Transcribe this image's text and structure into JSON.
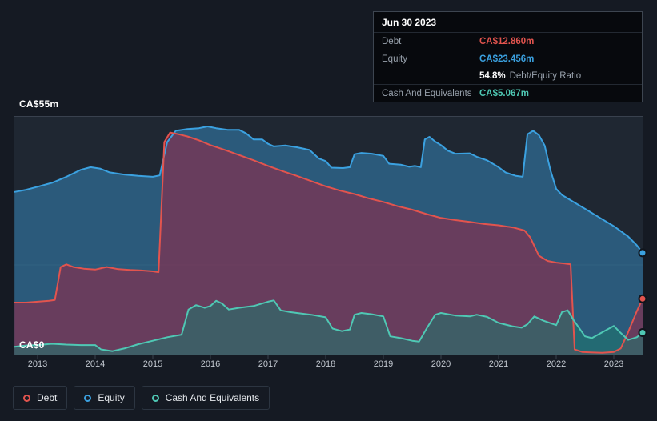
{
  "colors": {
    "debt": "#e2544e",
    "equity": "#3ba1e0",
    "cash": "#4fc8b4",
    "background": "#151a23",
    "plot_background": "#1f2732",
    "gridline": "#39414e",
    "muted_text": "#98a1ac"
  },
  "tooltip": {
    "date": "Jun 30 2023",
    "debt_label": "Debt",
    "debt_value": "CA$12.860m",
    "equity_label": "Equity",
    "equity_value": "CA$23.456m",
    "ratio_value": "54.8%",
    "ratio_label": "Debt/Equity Ratio",
    "cash_label": "Cash And Equivalents",
    "cash_value": "CA$5.067m"
  },
  "axis": {
    "y_top_label": "CA$55m",
    "y_zero_label": "CA$0",
    "years": [
      "2013",
      "2014",
      "2015",
      "2016",
      "2017",
      "2018",
      "2019",
      "2020",
      "2021",
      "2022",
      "2023"
    ]
  },
  "legend": [
    {
      "label": "Debt",
      "color": "#e2544e"
    },
    {
      "label": "Equity",
      "color": "#3ba1e0"
    },
    {
      "label": "Cash And Equivalents",
      "color": "#4fc8b4"
    }
  ],
  "chart_data": {
    "type": "area",
    "title": "",
    "xlabel": "",
    "ylabel": "",
    "y_unit": "CA$m",
    "ylim": [
      0,
      55
    ],
    "xlim": [
      2012.6,
      2023.5
    ],
    "x_ticks": [
      2013,
      2014,
      2015,
      2016,
      2017,
      2018,
      2019,
      2020,
      2021,
      2022,
      2023
    ],
    "y_tick_labels": [
      "CA$0",
      "CA$55m"
    ],
    "legend_position": "bottom-left",
    "latest": {
      "date": "Jun 30 2023",
      "debt": 12.86,
      "equity": 23.456,
      "debt_equity_ratio_pct": 54.8,
      "cash_and_equivalents": 5.067
    },
    "series": [
      {
        "name": "Equity",
        "color": "#3ba1e0",
        "fill": "rgba(59,161,224,0.42)",
        "points": [
          [
            2012.6,
            37.5
          ],
          [
            2012.8,
            38
          ],
          [
            2013,
            38.7
          ],
          [
            2013.25,
            39.6
          ],
          [
            2013.5,
            41
          ],
          [
            2013.75,
            42.6
          ],
          [
            2013.92,
            43.2
          ],
          [
            2014.08,
            42.9
          ],
          [
            2014.25,
            42
          ],
          [
            2014.5,
            41.5
          ],
          [
            2014.75,
            41.2
          ],
          [
            2015,
            41
          ],
          [
            2015.12,
            41.3
          ],
          [
            2015.25,
            49
          ],
          [
            2015.4,
            51.6
          ],
          [
            2015.6,
            52
          ],
          [
            2015.8,
            52.2
          ],
          [
            2015.95,
            52.6
          ],
          [
            2016.1,
            52.2
          ],
          [
            2016.3,
            51.8
          ],
          [
            2016.5,
            51.8
          ],
          [
            2016.62,
            51
          ],
          [
            2016.75,
            49.6
          ],
          [
            2016.9,
            49.6
          ],
          [
            2017,
            48.6
          ],
          [
            2017.1,
            48
          ],
          [
            2017.3,
            48.2
          ],
          [
            2017.5,
            47.8
          ],
          [
            2017.72,
            47.2
          ],
          [
            2017.88,
            45.2
          ],
          [
            2018,
            44.6
          ],
          [
            2018.1,
            43.1
          ],
          [
            2018.3,
            43
          ],
          [
            2018.42,
            43.2
          ],
          [
            2018.5,
            46.2
          ],
          [
            2018.62,
            46.5
          ],
          [
            2018.8,
            46.3
          ],
          [
            2019,
            45.8
          ],
          [
            2019.1,
            44
          ],
          [
            2019.3,
            43.8
          ],
          [
            2019.45,
            43.3
          ],
          [
            2019.55,
            43.5
          ],
          [
            2019.65,
            43.2
          ],
          [
            2019.72,
            49.6
          ],
          [
            2019.8,
            50.2
          ],
          [
            2019.9,
            49.1
          ],
          [
            2020,
            48.3
          ],
          [
            2020.12,
            47
          ],
          [
            2020.25,
            46.3
          ],
          [
            2020.5,
            46.4
          ],
          [
            2020.62,
            45.6
          ],
          [
            2020.8,
            44.8
          ],
          [
            2021,
            43.2
          ],
          [
            2021.12,
            42
          ],
          [
            2021.3,
            41.2
          ],
          [
            2021.42,
            41
          ],
          [
            2021.5,
            50.8
          ],
          [
            2021.6,
            51.6
          ],
          [
            2021.7,
            50.6
          ],
          [
            2021.8,
            48.2
          ],
          [
            2021.9,
            42.5
          ],
          [
            2022,
            38.2
          ],
          [
            2022.1,
            36.8
          ],
          [
            2022.25,
            35.6
          ],
          [
            2022.5,
            33.6
          ],
          [
            2022.75,
            31.6
          ],
          [
            2023,
            29.6
          ],
          [
            2023.25,
            27.2
          ],
          [
            2023.4,
            25.2
          ],
          [
            2023.5,
            23.456
          ]
        ]
      },
      {
        "name": "Debt",
        "color": "#e2544e",
        "fill": "rgba(155,38,70,0.55)",
        "points": [
          [
            2012.6,
            12
          ],
          [
            2012.8,
            12
          ],
          [
            2013,
            12.2
          ],
          [
            2013.2,
            12.4
          ],
          [
            2013.3,
            12.6
          ],
          [
            2013.4,
            20.2
          ],
          [
            2013.5,
            20.8
          ],
          [
            2013.62,
            20.2
          ],
          [
            2013.8,
            19.8
          ],
          [
            2014,
            19.6
          ],
          [
            2014.2,
            20.2
          ],
          [
            2014.4,
            19.7
          ],
          [
            2014.6,
            19.5
          ],
          [
            2014.8,
            19.4
          ],
          [
            2015,
            19.2
          ],
          [
            2015.1,
            19
          ],
          [
            2015.2,
            49
          ],
          [
            2015.3,
            51.2
          ],
          [
            2015.45,
            50.8
          ],
          [
            2015.6,
            50.3
          ],
          [
            2015.8,
            49.4
          ],
          [
            2016,
            48.3
          ],
          [
            2016.25,
            47.2
          ],
          [
            2016.5,
            46
          ],
          [
            2016.75,
            44.8
          ],
          [
            2017,
            43.5
          ],
          [
            2017.25,
            42.3
          ],
          [
            2017.5,
            41.2
          ],
          [
            2017.75,
            40
          ],
          [
            2018,
            38.8
          ],
          [
            2018.25,
            37.8
          ],
          [
            2018.5,
            37
          ],
          [
            2018.75,
            36
          ],
          [
            2019,
            35.2
          ],
          [
            2019.25,
            34.2
          ],
          [
            2019.5,
            33.4
          ],
          [
            2019.75,
            32.4
          ],
          [
            2020,
            31.5
          ],
          [
            2020.25,
            31
          ],
          [
            2020.5,
            30.6
          ],
          [
            2020.75,
            30.1
          ],
          [
            2021,
            29.8
          ],
          [
            2021.25,
            29.3
          ],
          [
            2021.45,
            28.6
          ],
          [
            2021.55,
            27
          ],
          [
            2021.7,
            22.8
          ],
          [
            2021.85,
            21.6
          ],
          [
            2022,
            21.2
          ],
          [
            2022.15,
            21
          ],
          [
            2022.25,
            20.8
          ],
          [
            2022.32,
            1.2
          ],
          [
            2022.45,
            0.6
          ],
          [
            2022.6,
            0.5
          ],
          [
            2022.8,
            0.4
          ],
          [
            2023,
            0.6
          ],
          [
            2023.12,
            1.4
          ],
          [
            2023.25,
            5.2
          ],
          [
            2023.4,
            10
          ],
          [
            2023.5,
            12.86
          ]
        ]
      },
      {
        "name": "Cash And Equivalents",
        "color": "#4fc8b4",
        "fill": "rgba(30,120,110,0.55)",
        "points": [
          [
            2012.6,
            1.8
          ],
          [
            2012.8,
            2.1
          ],
          [
            2013,
            2.2
          ],
          [
            2013.25,
            2.5
          ],
          [
            2013.5,
            2.3
          ],
          [
            2013.75,
            2.2
          ],
          [
            2014,
            2.2
          ],
          [
            2014.1,
            1.2
          ],
          [
            2014.3,
            0.8
          ],
          [
            2014.5,
            1.4
          ],
          [
            2014.75,
            2.4
          ],
          [
            2015,
            3.2
          ],
          [
            2015.25,
            4
          ],
          [
            2015.5,
            4.6
          ],
          [
            2015.62,
            10.4
          ],
          [
            2015.75,
            11.4
          ],
          [
            2015.9,
            10.8
          ],
          [
            2016,
            11.2
          ],
          [
            2016.1,
            12.4
          ],
          [
            2016.2,
            11.8
          ],
          [
            2016.32,
            10.4
          ],
          [
            2016.5,
            10.8
          ],
          [
            2016.75,
            11.2
          ],
          [
            2017,
            12.2
          ],
          [
            2017.1,
            12.5
          ],
          [
            2017.22,
            10.2
          ],
          [
            2017.38,
            9.8
          ],
          [
            2017.5,
            9.6
          ],
          [
            2017.75,
            9.2
          ],
          [
            2018,
            8.6
          ],
          [
            2018.12,
            6
          ],
          [
            2018.28,
            5.4
          ],
          [
            2018.42,
            5.8
          ],
          [
            2018.5,
            9.2
          ],
          [
            2018.62,
            9.6
          ],
          [
            2018.8,
            9.3
          ],
          [
            2019,
            8.8
          ],
          [
            2019.12,
            4.2
          ],
          [
            2019.3,
            3.8
          ],
          [
            2019.5,
            3.2
          ],
          [
            2019.62,
            3
          ],
          [
            2019.75,
            6
          ],
          [
            2019.9,
            9.2
          ],
          [
            2020,
            9.6
          ],
          [
            2020.25,
            9
          ],
          [
            2020.5,
            8.8
          ],
          [
            2020.62,
            9.2
          ],
          [
            2020.8,
            8.7
          ],
          [
            2021,
            7.3
          ],
          [
            2021.25,
            6.5
          ],
          [
            2021.4,
            6.2
          ],
          [
            2021.5,
            7
          ],
          [
            2021.62,
            8.8
          ],
          [
            2021.78,
            7.8
          ],
          [
            2022,
            6.8
          ],
          [
            2022.1,
            9.8
          ],
          [
            2022.2,
            10.2
          ],
          [
            2022.3,
            8
          ],
          [
            2022.5,
            4.2
          ],
          [
            2022.62,
            3.8
          ],
          [
            2022.78,
            5
          ],
          [
            2023,
            6.6
          ],
          [
            2023.12,
            5
          ],
          [
            2023.25,
            3.4
          ],
          [
            2023.4,
            4
          ],
          [
            2023.5,
            5.067
          ]
        ]
      }
    ]
  }
}
